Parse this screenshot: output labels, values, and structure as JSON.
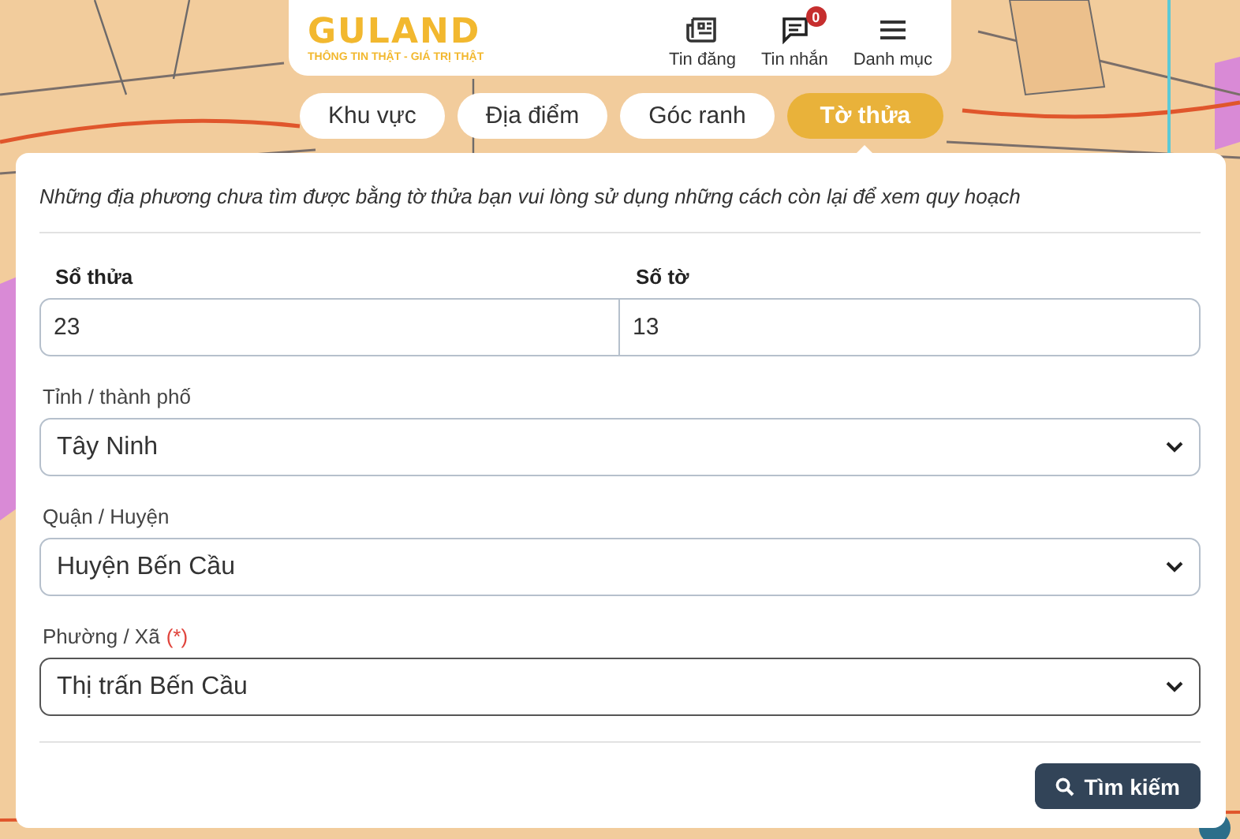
{
  "header": {
    "logo": "GULAND",
    "tagline": "THÔNG TIN THẬT - GIÁ TRỊ THẬT",
    "nav": [
      {
        "kind": "news",
        "label": "Tin đăng"
      },
      {
        "kind": "chat",
        "label": "Tin nhắn",
        "badge": "0"
      },
      {
        "kind": "menu",
        "label": "Danh mục"
      }
    ]
  },
  "tabs": [
    {
      "label": "Khu vực",
      "selected": false
    },
    {
      "label": "Địa điểm",
      "selected": false
    },
    {
      "label": "Góc ranh",
      "selected": false
    },
    {
      "label": "Tờ thửa",
      "selected": true
    }
  ],
  "panel": {
    "note": "Những địa phương chưa tìm được bằng tờ thửa bạn vui lòng sử dụng những cách còn lại để xem quy hoạch",
    "number_fields": [
      {
        "label": "Sổ thửa",
        "value": "23"
      },
      {
        "label": "Số tờ",
        "value": "13"
      }
    ],
    "selects": [
      {
        "label": "Tỉnh / thành phố",
        "value": "Tây Ninh",
        "focused": false
      },
      {
        "label": "Quận / Huyện",
        "value": "Huyện Bến Cầu",
        "focused": false
      },
      {
        "label": "Phường / Xã",
        "required_mark": "(*)",
        "value": "Thị trấn Bến Cầu",
        "focused": true
      }
    ],
    "search_button": "Tìm kiếm"
  }
}
